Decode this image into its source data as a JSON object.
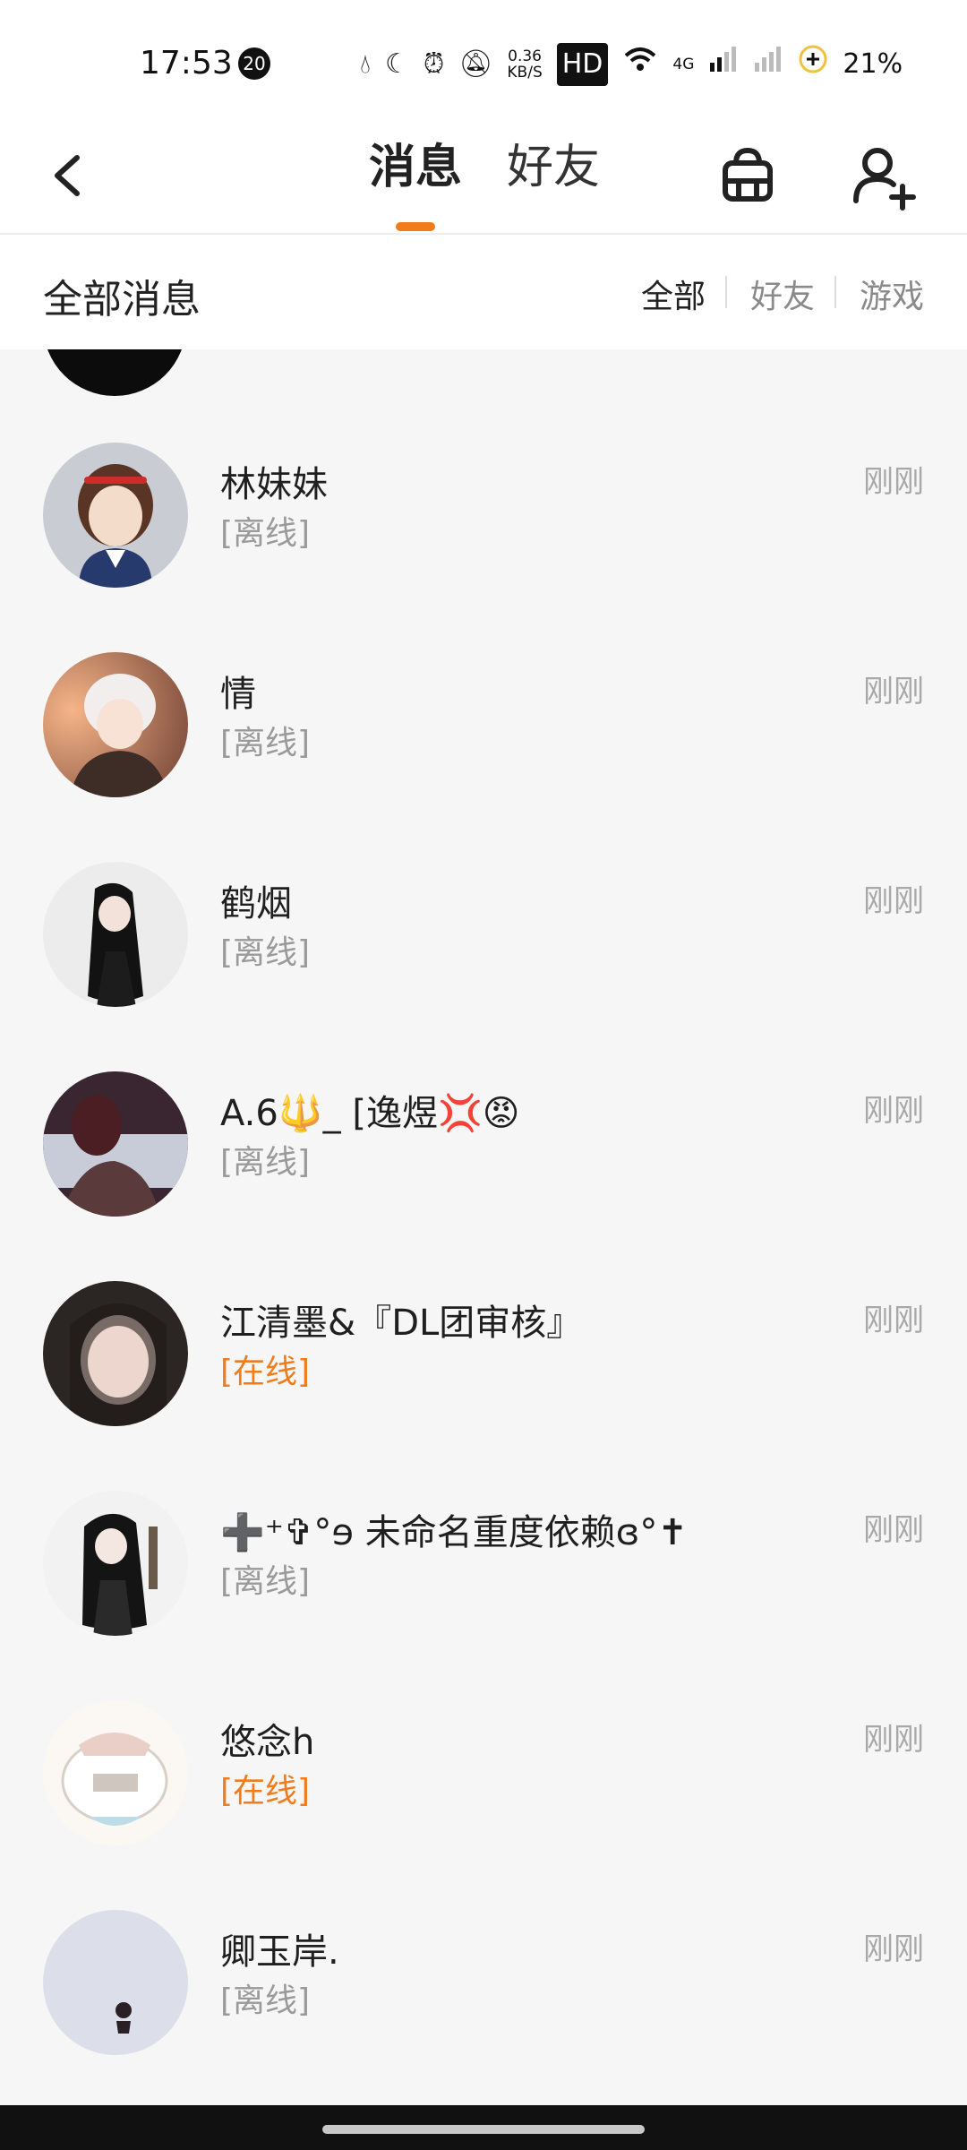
{
  "status_bar": {
    "time": "17:53",
    "notif_count": "20",
    "net_speed_value": "0.36",
    "net_speed_unit": "KB/S",
    "hd_label": "HD",
    "network_label": "4G",
    "battery": "21%"
  },
  "header": {
    "tab_messages": "消息",
    "tab_friends": "好友",
    "accent_color": "#f07c1c"
  },
  "filter_bar": {
    "title": "全部消息",
    "filters": [
      "全部",
      "好友",
      "游戏"
    ],
    "selected": "全部"
  },
  "messages": [
    {
      "name": "林妹妹",
      "status": "[离线]",
      "online": false,
      "time": "刚刚"
    },
    {
      "name": "情",
      "status": "[离线]",
      "online": false,
      "time": "刚刚"
    },
    {
      "name": "鹤烟",
      "status": "[离线]",
      "online": false,
      "time": "刚刚"
    },
    {
      "name": "A.6🔱_ [逸煜💢😡",
      "status": "[离线]",
      "online": false,
      "time": "刚刚"
    },
    {
      "name": "江清墨&『DL团审核』",
      "status": "[在线]",
      "online": true,
      "time": "刚刚"
    },
    {
      "name": "➕⁺✞°ɘ 未命名重度依赖ɞ°✝",
      "status": "[离线]",
      "online": false,
      "time": "刚刚"
    },
    {
      "name": "悠念h",
      "status": "[在线]",
      "online": true,
      "time": "刚刚"
    },
    {
      "name": "卿玉岸.",
      "status": "[离线]",
      "online": false,
      "time": "刚刚"
    }
  ]
}
